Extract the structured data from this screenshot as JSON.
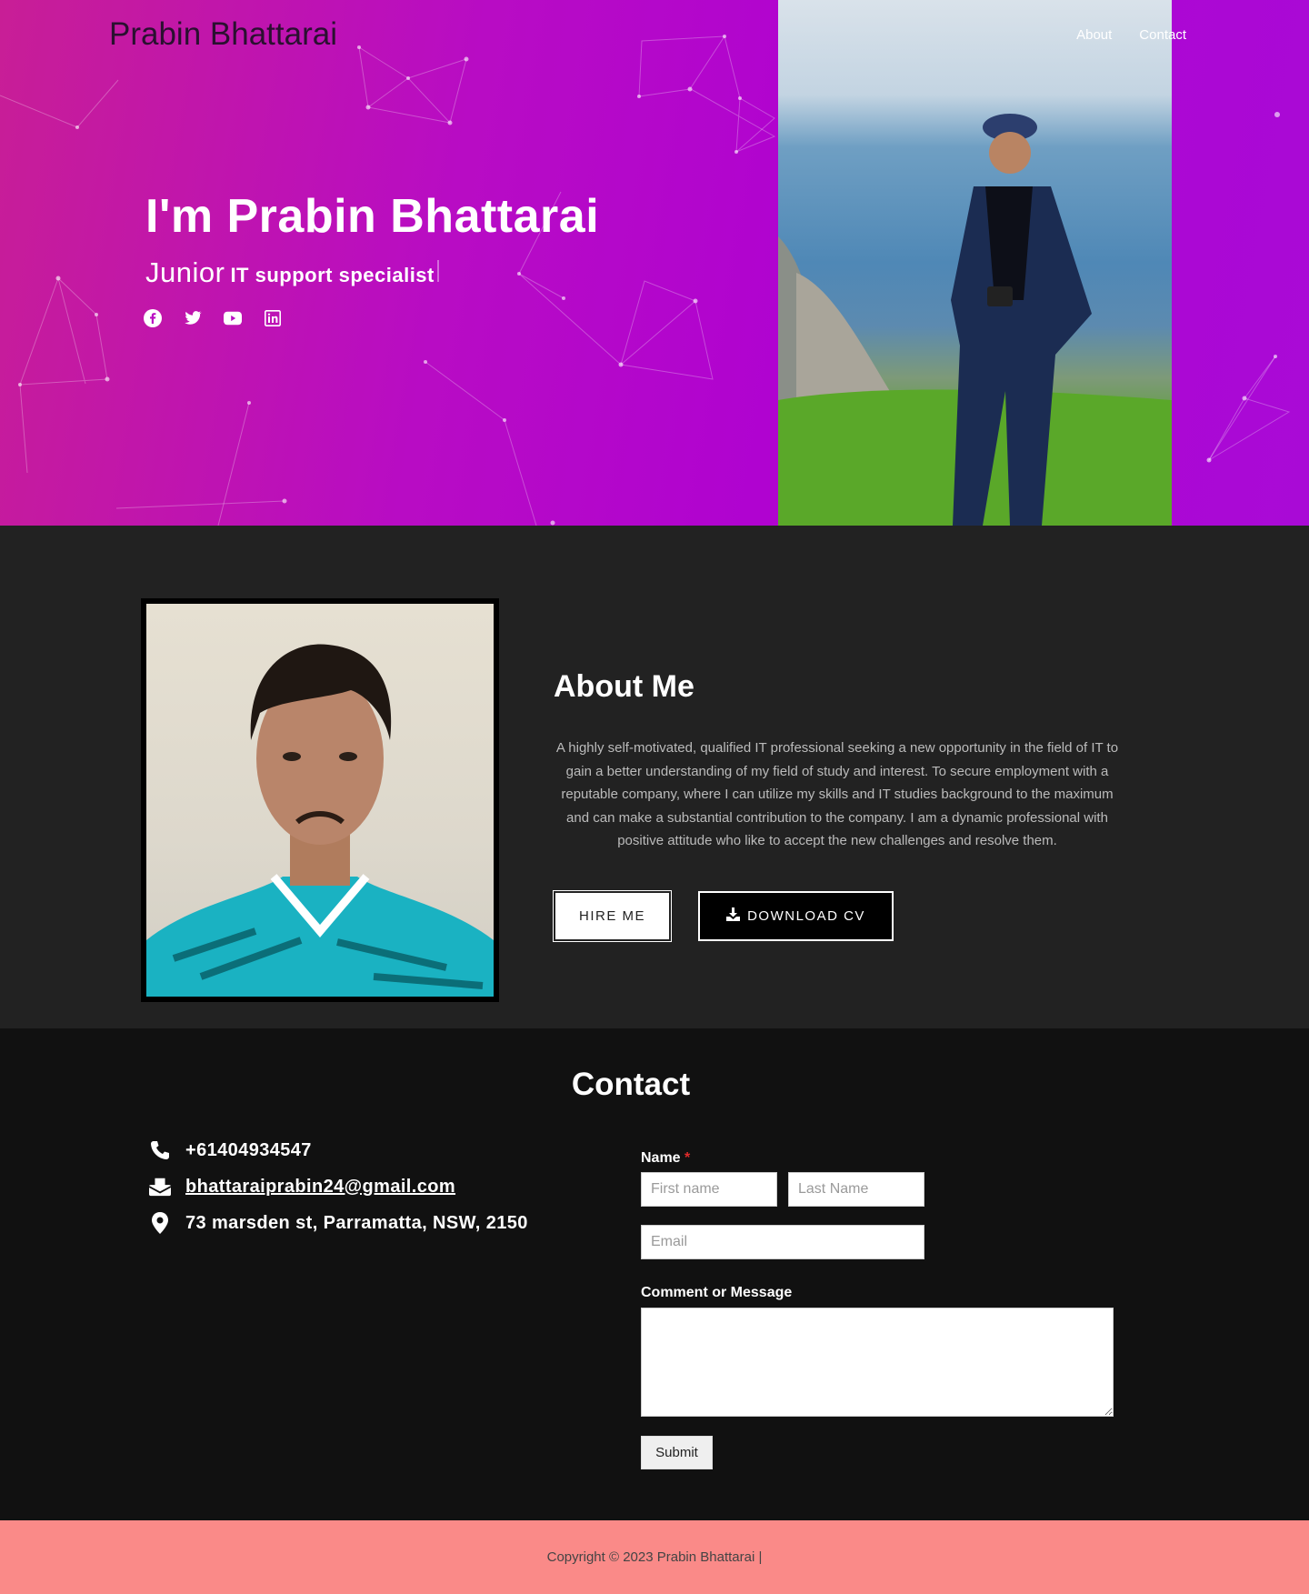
{
  "header": {
    "site_title": "Prabin Bhattarai",
    "nav": [
      {
        "label": "About"
      },
      {
        "label": "Contact"
      }
    ]
  },
  "hero": {
    "greeting": "I'm Prabin Bhattarai",
    "role_prefix": "Junior",
    "role_typed": "IT support specialist",
    "social_icons": [
      "facebook-icon",
      "twitter-icon",
      "youtube-icon",
      "linkedin-icon"
    ],
    "background_colors": [
      "#c81e96",
      "#b003d0",
      "#a90ad6"
    ]
  },
  "about": {
    "heading": "About Me",
    "bio": "A highly self-motivated, qualified IT professional seeking a new opportunity in the field of IT to gain a better understanding of my field of study and interest. To secure employment with a reputable company, where I can utilize my skills and IT studies background to the maximum and can make a substantial contribution to the company. I am a dynamic professional with positive attitude who like to accept the new challenges and resolve them.",
    "hire_label": "HIRE ME",
    "cv_label": "DOWNLOAD CV",
    "background_color": "#222222"
  },
  "contact": {
    "heading": "Contact",
    "phone": "+61404934547",
    "email": "bhattaraiprabin24@gmail.com",
    "address": "73 marsden st, Parramatta, NSW, 2150",
    "form": {
      "name_label": "Name",
      "required_mark": "*",
      "first_placeholder": "First name",
      "last_placeholder": "Last Name",
      "email_placeholder": "Email",
      "message_label": "Comment or Message",
      "submit_label": "Submit"
    }
  },
  "footer": {
    "copyright": "Copyright © 2023 Prabin Bhattarai |",
    "background_color": "#fa8a88"
  }
}
